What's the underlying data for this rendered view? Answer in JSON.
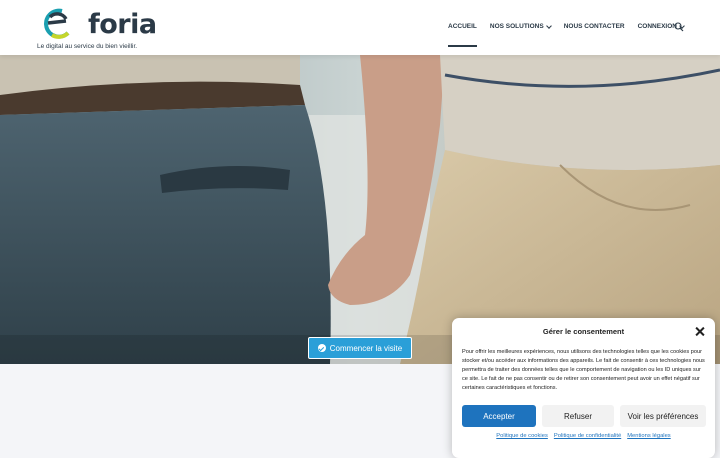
{
  "header": {
    "logo_text": "foria",
    "logo_e": "e",
    "tagline": "Le digital au service du bien vieillir.",
    "nav": [
      {
        "label": "ACCUEIL",
        "active": true
      },
      {
        "label": "NOS SOLUTIONS",
        "dropdown": true
      },
      {
        "label": "NOUS CONTACTER"
      },
      {
        "label": "CONNEXION",
        "dropdown": true
      }
    ],
    "search_icon": "search-icon"
  },
  "hero": {
    "cta_label": "Commencer la visite",
    "cta_icon": "check-circle-icon"
  },
  "consent": {
    "title": "Gérer le consentement",
    "body": "Pour offrir les meilleures expériences, nous utilisons des technologies telles que les cookies pour stocker et/ou accéder aux informations des appareils. Le fait de consentir à ces technologies nous permettra de traiter des données telles que le comportement de navigation ou les ID uniques sur ce site. Le fait de ne pas consentir ou de retirer son consentement peut avoir un effet négatif sur certaines caractéristiques et fonctions.",
    "accept": "Accepter",
    "refuse": "Refuser",
    "prefs": "Voir les préférences",
    "links": [
      "Politique de cookies",
      "Politique de confidentialité",
      "Mentions légales"
    ]
  },
  "colors": {
    "brand_dark": "#2b3a47",
    "cta_blue": "#2a9fd8",
    "accept_blue": "#1e73be",
    "logo_yellow": "#c5d62b",
    "logo_teal": "#1a9fb0"
  }
}
